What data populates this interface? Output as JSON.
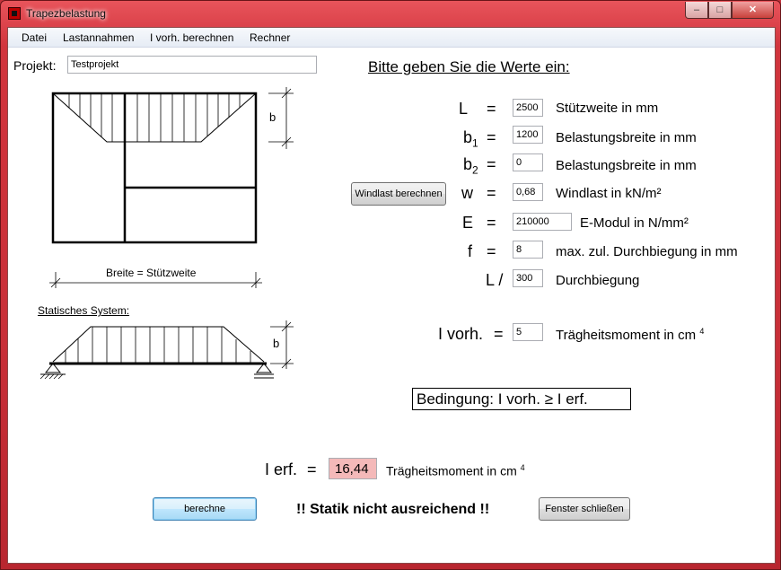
{
  "window": {
    "title": "Trapezbelastung",
    "controls": {
      "minimize": "–",
      "maximize": "□",
      "close": "✕"
    }
  },
  "menu": [
    "Datei",
    "Lastannahmen",
    "I vorh. berechnen",
    "Rechner"
  ],
  "project": {
    "label": "Projekt:",
    "value": "Testprojekt"
  },
  "heading": "Bitte geben Sie die Werte ein:",
  "diagram": {
    "b_label": "b",
    "width_label": "Breite = Stützweite",
    "static_title": "Statisches System:",
    "static_b_label": "b"
  },
  "fields": {
    "L": {
      "symbol": "L",
      "eq": "=",
      "value": "2500",
      "desc": "Stützweite in mm"
    },
    "b1": {
      "symbol": "b",
      "sub": "1",
      "eq": "=",
      "value": "1200",
      "desc": "Belastungsbreite in mm"
    },
    "b2": {
      "symbol": "b",
      "sub": "2",
      "eq": "=",
      "value": "0",
      "desc": "Belastungsbreite in mm"
    },
    "w": {
      "symbol": "w",
      "eq": "=",
      "value": "0,68",
      "desc": "Windlast in kN/m²"
    },
    "E": {
      "symbol": "E",
      "eq": "=",
      "value": "210000",
      "desc": "E-Modul in N/mm²"
    },
    "f": {
      "symbol": "f",
      "eq": "=",
      "value": "8",
      "desc": "max. zul. Durchbiegung in mm"
    },
    "Ldiv": {
      "symbol": "L /",
      "value": "300",
      "desc": "Durchbiegung"
    }
  },
  "wind_button": "Windlast berechnen",
  "ivorh": {
    "symbol": "I vorh.",
    "eq": "=",
    "value": "5",
    "desc": "Trägheitsmoment in cm",
    "sup": "4"
  },
  "condition": "Bedingung:   I vorh.  ≥  I erf.",
  "ierf": {
    "symbol": "I erf.",
    "eq": "=",
    "value": "16,44",
    "desc": "Trägheitsmoment in cm",
    "sup": "4"
  },
  "calc_button": "berechne",
  "status": "!! Statik nicht ausreichend !!",
  "close_button": "Fenster schließen",
  "colors": {
    "frame": "#c4323b",
    "result_bg": "#f4b9b9"
  }
}
